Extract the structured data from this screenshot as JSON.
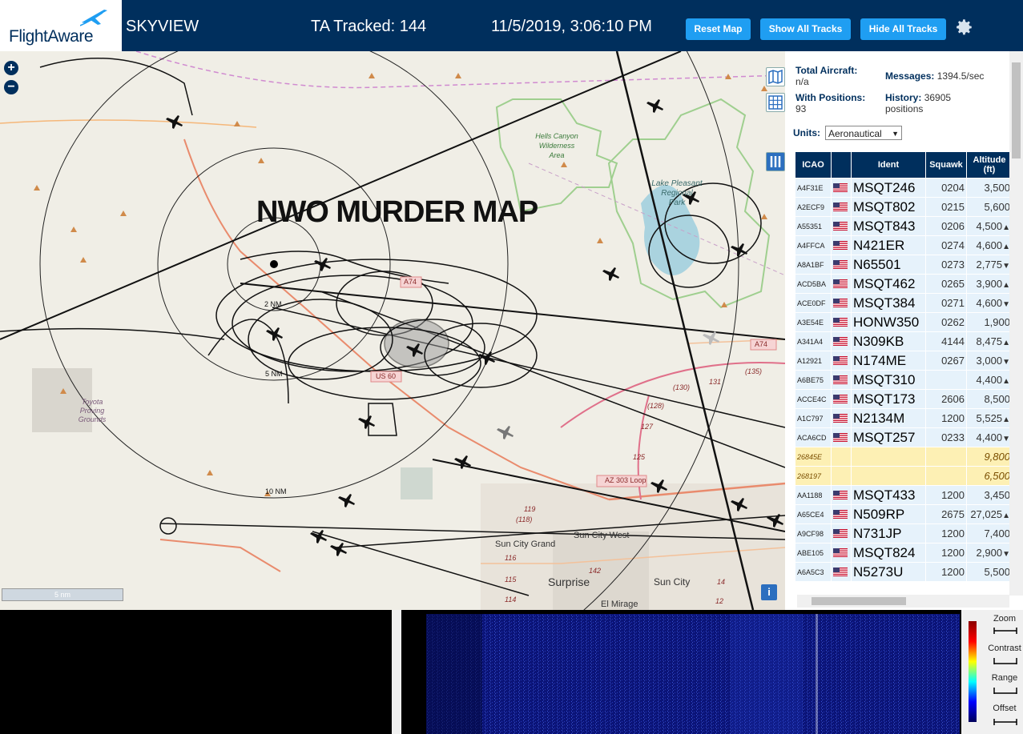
{
  "header": {
    "logo_text": "FlightAware",
    "app_name": "SKYVIEW",
    "tracked": "TA Tracked: 144",
    "datetime": "11/5/2019, 3:06:10 PM",
    "buttons": [
      "Reset Map",
      "Show All Tracks",
      "Hide All Tracks"
    ],
    "settings_icon": "gear-icon",
    "bg_color": "#002f5d",
    "button_color": "#1f9ef2"
  },
  "map": {
    "overlay_title": "NWO MURDER MAP",
    "zoom_in": "+",
    "zoom_out": "−",
    "labels": {
      "wilderness": [
        "Hells Canyon",
        "Wilderness",
        "Area"
      ],
      "lake": [
        "Lake Pleasant",
        "Regional",
        "Park"
      ],
      "proving": [
        "Toyota",
        "Proving",
        "Grounds"
      ],
      "ring_2": "2 NM",
      "ring_5": "5 NM",
      "ring_10": "10 NM",
      "us60": "US 60",
      "a74": "A74",
      "a74b": "A74",
      "az303": "AZ 303 Loop",
      "sun_city_grand": "Sun City Grand",
      "sun_city_west": "Sun City West",
      "surprise": "Surprise",
      "sun_city": "Sun City",
      "el_mirage": "El Mirage",
      "roads": [
        "(130)",
        "(128)",
        "127",
        "131",
        "(135)",
        "125",
        "119",
        "(118)",
        "116",
        "115",
        "114",
        "142",
        "14",
        "12"
      ]
    },
    "scale_label": "5 nm",
    "info_button": "i"
  },
  "stats": {
    "total_aircraft_label": "Total Aircraft:",
    "total_aircraft_value": "n/a",
    "with_positions_label": "With Positions:",
    "with_positions_value": "93",
    "messages_label": "Messages:",
    "messages_value": "1394.5/sec",
    "history_label": "History:",
    "history_value": "36905",
    "history_unit": "positions",
    "units_label": "Units:",
    "units_value": "Aeronautical"
  },
  "table": {
    "columns": [
      "ICAO",
      "",
      "Ident",
      "Squawk",
      "Altitude (ft)"
    ],
    "rows": [
      {
        "icao": "A4F31E",
        "flag": true,
        "ident": "MSQT246",
        "squawk": "0204",
        "alt": "3,500",
        "trend": ""
      },
      {
        "icao": "A2ECF9",
        "flag": true,
        "ident": "MSQT802",
        "squawk": "0215",
        "alt": "5,600",
        "trend": ""
      },
      {
        "icao": "A55351",
        "flag": true,
        "ident": "MSQT843",
        "squawk": "0206",
        "alt": "4,500",
        "trend": "▲"
      },
      {
        "icao": "A4FFCA",
        "flag": true,
        "ident": "N421ER",
        "squawk": "0274",
        "alt": "4,600",
        "trend": "▲"
      },
      {
        "icao": "A8A1BF",
        "flag": true,
        "ident": "N65501",
        "squawk": "0273",
        "alt": "2,775",
        "trend": "▼"
      },
      {
        "icao": "ACD5BA",
        "flag": true,
        "ident": "MSQT462",
        "squawk": "0265",
        "alt": "3,900",
        "trend": "▲"
      },
      {
        "icao": "ACE0DF",
        "flag": true,
        "ident": "MSQT384",
        "squawk": "0271",
        "alt": "4,600",
        "trend": "▼"
      },
      {
        "icao": "A3E54E",
        "flag": true,
        "ident": "HONW350",
        "squawk": "0262",
        "alt": "1,900",
        "trend": ""
      },
      {
        "icao": "A341A4",
        "flag": true,
        "ident": "N309KB",
        "squawk": "4144",
        "alt": "8,475",
        "trend": "▲"
      },
      {
        "icao": "A12921",
        "flag": true,
        "ident": "N174ME",
        "squawk": "0267",
        "alt": "3,000",
        "trend": "▼"
      },
      {
        "icao": "A6BE75",
        "flag": true,
        "ident": "MSQT310",
        "squawk": "",
        "alt": "4,400",
        "trend": "▲"
      },
      {
        "icao": "ACCE4C",
        "flag": true,
        "ident": "MSQT173",
        "squawk": "2606",
        "alt": "8,500",
        "trend": ""
      },
      {
        "icao": "A1C797",
        "flag": true,
        "ident": "N2134M",
        "squawk": "1200",
        "alt": "5,525",
        "trend": "▲"
      },
      {
        "icao": "ACA6CD",
        "flag": true,
        "ident": "MSQT257",
        "squawk": "0233",
        "alt": "4,400",
        "trend": "▼"
      },
      {
        "icao": "26845E",
        "flag": false,
        "ident": "",
        "squawk": "",
        "alt": "9,800",
        "trend": "",
        "special": true
      },
      {
        "icao": "268197",
        "flag": false,
        "ident": "",
        "squawk": "",
        "alt": "6,500",
        "trend": "",
        "special": true
      },
      {
        "icao": "AA1188",
        "flag": true,
        "ident": "MSQT433",
        "squawk": "1200",
        "alt": "3,450",
        "trend": ""
      },
      {
        "icao": "A65CE4",
        "flag": true,
        "ident": "N509RP",
        "squawk": "2675",
        "alt": "27,025",
        "trend": "▲"
      },
      {
        "icao": "A9CF98",
        "flag": true,
        "ident": "N731JP",
        "squawk": "1200",
        "alt": "7,400",
        "trend": ""
      },
      {
        "icao": "ABE105",
        "flag": true,
        "ident": "MSQT824",
        "squawk": "1200",
        "alt": "2,900",
        "trend": "▼"
      },
      {
        "icao": "A6A5C3",
        "flag": true,
        "ident": "N5273U",
        "squawk": "1200",
        "alt": "5,500",
        "trend": ""
      }
    ]
  },
  "spectrum": {
    "controls": [
      "Zoom",
      "Contrast",
      "Range",
      "Offset"
    ]
  }
}
